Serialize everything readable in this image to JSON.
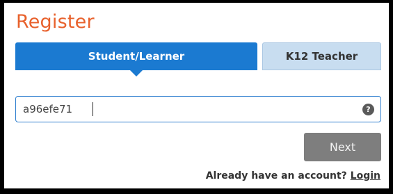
{
  "title": "Register",
  "tabs": [
    {
      "label": "Student/Learner",
      "active": true
    },
    {
      "label": "K12 Teacher",
      "active": false
    }
  ],
  "code_input": {
    "value": "a96efe71"
  },
  "help_icon": {
    "name": "help-icon",
    "glyph": "?"
  },
  "next_button": {
    "label": "Next"
  },
  "login_prompt": {
    "text": "Already have an account?",
    "link": "Login"
  },
  "colors": {
    "title": "#e8612c",
    "active_tab": "#1b7ad1",
    "inactive_tab": "#c8ddf0",
    "next_button": "#7e7e7e",
    "input_border": "#2f7fcf"
  }
}
